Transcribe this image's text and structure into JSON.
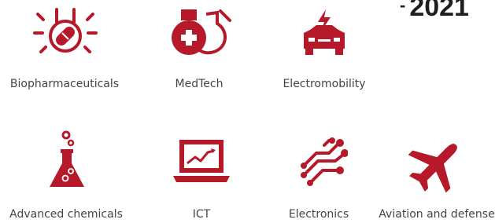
{
  "header": {
    "year_text": "2021",
    "dash": "-"
  },
  "accent_color": "#b5192a",
  "industries": [
    {
      "label": "Biopharmaceuticals",
      "icon": "pill-icon"
    },
    {
      "label": "MedTech",
      "icon": "medical-flasks-icon"
    },
    {
      "label": "Electromobility",
      "icon": "electric-car-icon"
    },
    {
      "label": "Advanced chemicals",
      "icon": "chemistry-flask-icon"
    },
    {
      "label": "ICT",
      "icon": "laptop-chart-icon"
    },
    {
      "label": "Electronics",
      "icon": "circuit-icon"
    },
    {
      "label": "Aviation and defense",
      "icon": "airplane-icon"
    }
  ]
}
